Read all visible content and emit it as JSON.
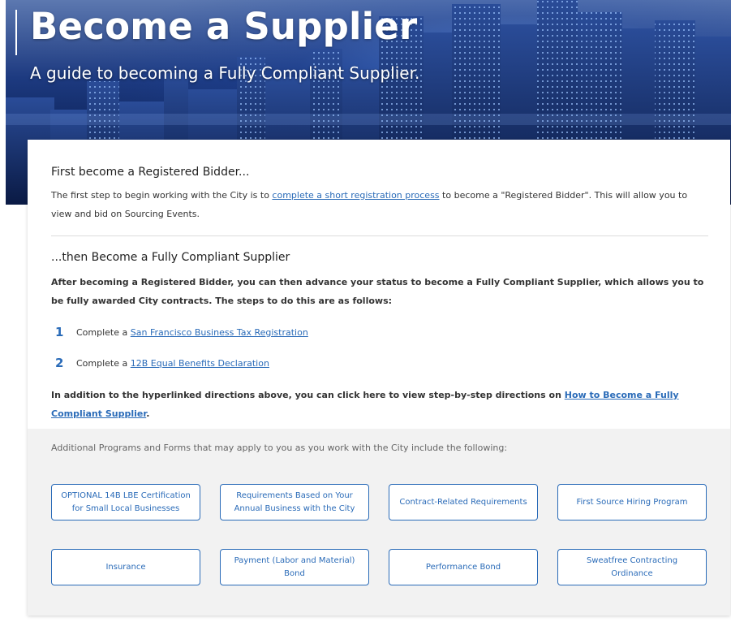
{
  "hero": {
    "title": "Become a Supplier",
    "subtitle": "A guide to becoming a Fully Compliant Supplier."
  },
  "section1": {
    "heading": "First become a Registered Bidder...",
    "text_before": "The first step to begin working with the City is to ",
    "link": "complete a short registration process",
    "text_after": " to become a \"Registered Bidder\". This will allow you to view and bid on Sourcing Events."
  },
  "section2": {
    "heading": "...then Become a Fully Compliant Supplier",
    "intro": "After becoming a Registered Bidder, you can then advance your status to become a Fully Compliant Supplier, which allows you to be fully awarded City contracts. The steps to do this are as follows:",
    "steps": [
      {
        "number": "1",
        "prefix": "Complete a ",
        "link": "San Francisco Business Tax Registration"
      },
      {
        "number": "2",
        "prefix": "Complete a ",
        "link": "12B Equal Benefits Declaration"
      }
    ],
    "footer_text": "In addition to the hyperlinked directions above, you can click here to view step-by-step directions on ",
    "footer_link": "How to Become a Fully Compliant Supplier",
    "footer_end": "."
  },
  "programs": {
    "intro": "Additional Programs and Forms that may apply to you as you work with the City include the following:",
    "buttons": [
      "OPTIONAL 14B LBE Certification for Small Local Businesses",
      "Requirements Based on Your Annual Business with the City",
      "Contract-Related Requirements",
      "First Source Hiring Program",
      "Insurance",
      "Payment (Labor and Material) Bond",
      "Performance Bond",
      "Sweatfree Contracting Ordinance"
    ]
  },
  "colors": {
    "link": "#2a6bb8",
    "hero_dark": "#0c2258",
    "panel_bg": "#f2f2f2"
  }
}
